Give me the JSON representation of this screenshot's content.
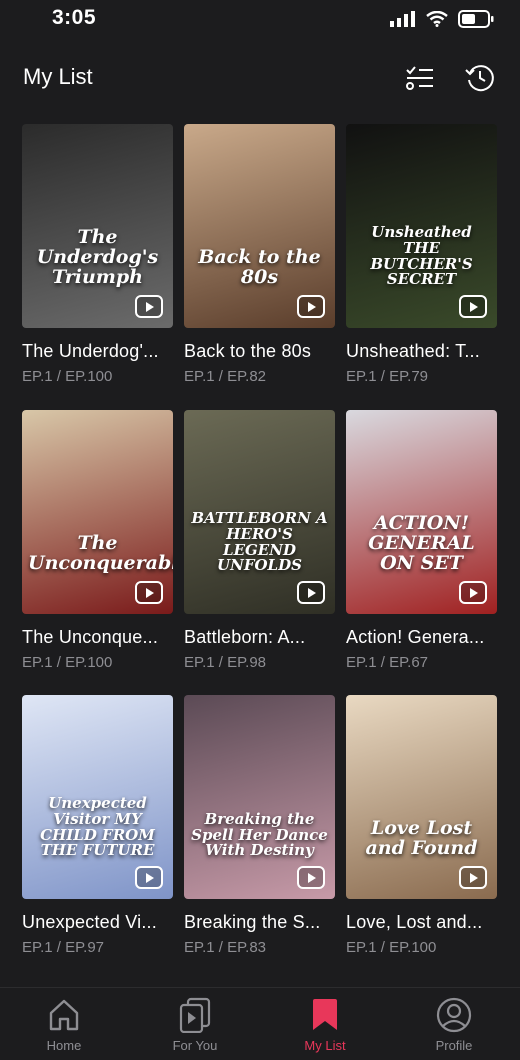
{
  "status_bar": {
    "time": "3:05"
  },
  "header": {
    "title": "My List"
  },
  "items": [
    {
      "title": "The Underdog'...",
      "episodes": "EP.1 / EP.100",
      "poster_text": "The Underdog's Triumph",
      "colors": [
        "#2b2b2b",
        "#6b6b6b"
      ]
    },
    {
      "title": "Back to the 80s",
      "episodes": "EP.1 / EP.82",
      "poster_text": "Back to the 80s",
      "colors": [
        "#c9a98a",
        "#5a3d2b"
      ]
    },
    {
      "title": "Unsheathed: T...",
      "episodes": "EP.1 / EP.79",
      "poster_text": "Unsheathed THE BUTCHER'S SECRET",
      "colors": [
        "#111111",
        "#3a4a2a"
      ]
    },
    {
      "title": "The Unconque...",
      "episodes": "EP.1 / EP.100",
      "poster_text": "The Unconquerable",
      "colors": [
        "#d8c7a8",
        "#7a1a1a"
      ]
    },
    {
      "title": "Battleborn: A...",
      "episodes": "EP.1 / EP.98",
      "poster_text": "BATTLEBORN A HERO'S LEGEND UNFOLDS",
      "colors": [
        "#6b6a55",
        "#2f2f25"
      ]
    },
    {
      "title": "Action! Genera...",
      "episodes": "EP.1 / EP.67",
      "poster_text": "ACTION! GENERAL ON SET",
      "colors": [
        "#d9d9df",
        "#a02020"
      ]
    },
    {
      "title": "Unexpected Vi...",
      "episodes": "EP.1 / EP.97",
      "poster_text": "Unexpected Visitor MY CHILD FROM THE FUTURE",
      "colors": [
        "#dfe6f5",
        "#7f94c8"
      ]
    },
    {
      "title": "Breaking the S...",
      "episodes": "EP.1 / EP.83",
      "poster_text": "Breaking the Spell Her Dance With Destiny",
      "colors": [
        "#5b4a55",
        "#c79aa8"
      ]
    },
    {
      "title": "Love, Lost and...",
      "episodes": "EP.1 / EP.100",
      "poster_text": "Love Lost and Found",
      "colors": [
        "#e9d9c2",
        "#8a6b4f"
      ]
    }
  ],
  "nav": [
    {
      "label": "Home",
      "icon": "home-icon",
      "active": false
    },
    {
      "label": "For You",
      "icon": "play-stack-icon",
      "active": false
    },
    {
      "label": "My List",
      "icon": "bookmark-icon",
      "active": true
    },
    {
      "label": "Profile",
      "icon": "profile-icon",
      "active": false
    }
  ],
  "accent_color": "#e8375a"
}
